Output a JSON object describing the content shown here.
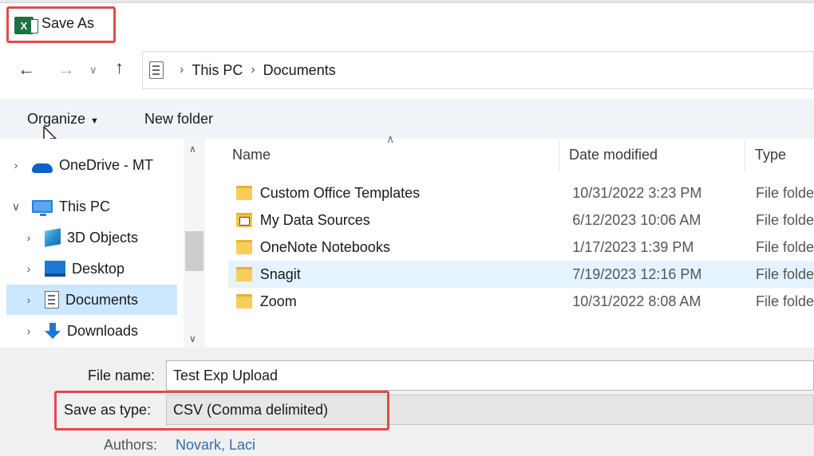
{
  "window": {
    "title": "Save As",
    "app_icon": "excel-icon",
    "app_icon_letter": "X"
  },
  "address": {
    "crumbs": [
      "This PC",
      "Documents"
    ]
  },
  "toolbar": {
    "organize_label": "Organize",
    "new_folder_label": "New folder"
  },
  "nav_pane": {
    "items": [
      {
        "label": "OneDrive - MT",
        "icon": "onedrive-icon"
      },
      {
        "label": "This PC",
        "icon": "this-pc-icon"
      },
      {
        "label": "3D Objects",
        "icon": "3d-objects-icon"
      },
      {
        "label": "Desktop",
        "icon": "desktop-icon"
      },
      {
        "label": "Documents",
        "icon": "documents-icon",
        "selected": true
      },
      {
        "label": "Downloads",
        "icon": "downloads-icon"
      }
    ]
  },
  "file_list": {
    "columns": [
      "Name",
      "Date modified",
      "Type"
    ],
    "rows": [
      {
        "name": "Custom Office Templates",
        "date": "10/31/2022 3:23 PM",
        "type": "File folder"
      },
      {
        "name": "My Data Sources",
        "date": "6/12/2023 10:06 AM",
        "type": "File folder"
      },
      {
        "name": "OneNote Notebooks",
        "date": "1/17/2023 1:39 PM",
        "type": "File folder"
      },
      {
        "name": "Snagit",
        "date": "7/19/2023 12:16 PM",
        "type": "File folder",
        "selected": true
      },
      {
        "name": "Zoom",
        "date": "10/31/2022 8:08 AM",
        "type": "File folder"
      }
    ]
  },
  "form": {
    "file_name_label": "File name:",
    "file_name_value": "Test Exp Upload",
    "save_type_label": "Save as type:",
    "save_type_value": "CSV (Comma delimited)",
    "authors_label": "Authors:",
    "authors_value": "Novark, Laci"
  },
  "colors": {
    "highlight_box": "#e34a4a",
    "selection": "#cce8ff",
    "link": "#2d6db5"
  }
}
